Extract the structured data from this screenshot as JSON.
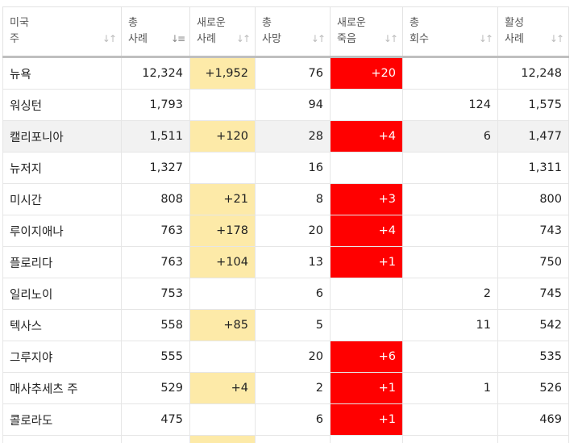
{
  "colors": {
    "new_cases_highlight": "#fdeaa8",
    "new_deaths_highlight": "#ff0000"
  },
  "headers": [
    {
      "line1": "미국",
      "line2": "주",
      "sort_icon": "sort-both-icon"
    },
    {
      "line1": "총",
      "line2": "사례",
      "sort_icon": "sort-descending-icon"
    },
    {
      "line1": "새로운",
      "line2": "사례",
      "sort_icon": "sort-both-icon"
    },
    {
      "line1": "총",
      "line2": "사망",
      "sort_icon": "sort-both-icon"
    },
    {
      "line1": "새로운",
      "line2": "죽음",
      "sort_icon": "sort-both-icon"
    },
    {
      "line1": "총",
      "line2": "회수",
      "sort_icon": "sort-both-icon"
    },
    {
      "line1": "활성",
      "line2": "사례",
      "sort_icon": "sort-both-icon"
    }
  ],
  "rows": [
    {
      "state": "뉴욕",
      "total_cases": "12,324",
      "new_cases": "+1,952",
      "total_deaths": "76",
      "new_deaths": "+20",
      "total_recovered": "",
      "active_cases": "12,248"
    },
    {
      "state": "워싱턴",
      "total_cases": "1,793",
      "new_cases": "",
      "total_deaths": "94",
      "new_deaths": "",
      "total_recovered": "124",
      "active_cases": "1,575"
    },
    {
      "state": "캘리포니아",
      "total_cases": "1,511",
      "new_cases": "+120",
      "total_deaths": "28",
      "new_deaths": "+4",
      "total_recovered": "6",
      "active_cases": "1,477"
    },
    {
      "state": "뉴저지",
      "total_cases": "1,327",
      "new_cases": "",
      "total_deaths": "16",
      "new_deaths": "",
      "total_recovered": "",
      "active_cases": "1,311"
    },
    {
      "state": "미시간",
      "total_cases": "808",
      "new_cases": "+21",
      "total_deaths": "8",
      "new_deaths": "+3",
      "total_recovered": "",
      "active_cases": "800"
    },
    {
      "state": "루이지애나",
      "total_cases": "763",
      "new_cases": "+178",
      "total_deaths": "20",
      "new_deaths": "+4",
      "total_recovered": "",
      "active_cases": "743"
    },
    {
      "state": "플로리다",
      "total_cases": "763",
      "new_cases": "+104",
      "total_deaths": "13",
      "new_deaths": "+1",
      "total_recovered": "",
      "active_cases": "750"
    },
    {
      "state": "일리노이",
      "total_cases": "753",
      "new_cases": "",
      "total_deaths": "6",
      "new_deaths": "",
      "total_recovered": "2",
      "active_cases": "745"
    },
    {
      "state": "텍사스",
      "total_cases": "558",
      "new_cases": "+85",
      "total_deaths": "5",
      "new_deaths": "",
      "total_recovered": "11",
      "active_cases": "542"
    },
    {
      "state": "그루지야",
      "total_cases": "555",
      "new_cases": "",
      "total_deaths": "20",
      "new_deaths": "+6",
      "total_recovered": "",
      "active_cases": "535"
    },
    {
      "state": "매사추세츠 주",
      "total_cases": "529",
      "new_cases": "+4",
      "total_deaths": "2",
      "new_deaths": "+1",
      "total_recovered": "1",
      "active_cases": "526"
    },
    {
      "state": "콜로라도",
      "total_cases": "475",
      "new_cases": "",
      "total_deaths": "6",
      "new_deaths": "+1",
      "total_recovered": "",
      "active_cases": "469"
    }
  ]
}
